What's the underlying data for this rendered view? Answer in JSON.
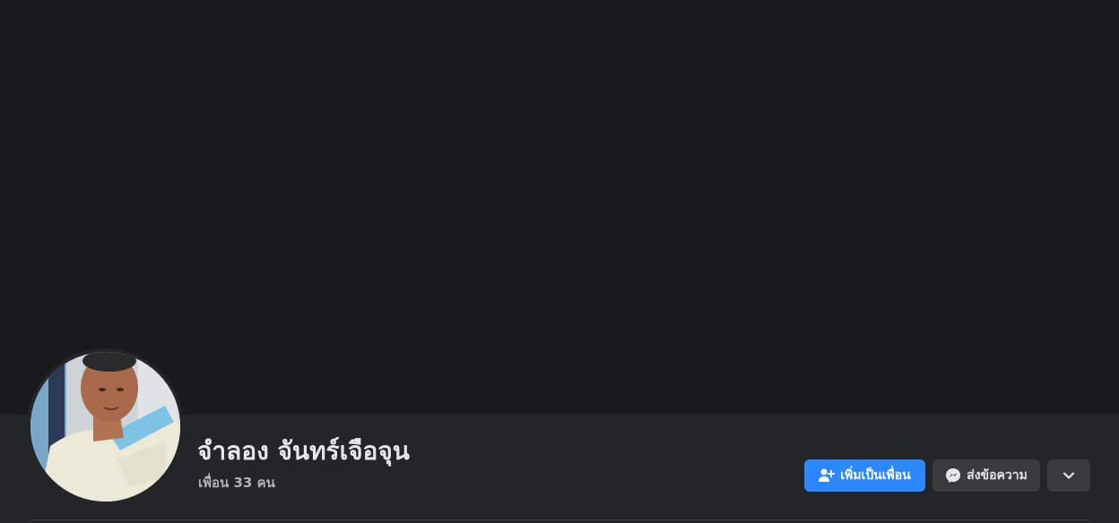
{
  "profile": {
    "name": "จำลอง จันทร์เจือจุน",
    "friends_text": "เพื่อน 33 คน"
  },
  "actions": {
    "add_friend_label": "เพิ่มเป็นเพื่อน",
    "add_friend_icon": "add-friend-icon",
    "message_label": "ส่งข้อความ",
    "message_icon": "messenger-icon",
    "more_icon": "chevron-down-icon"
  },
  "colors": {
    "background": "#1a1a1c",
    "profile_bar": "#242527",
    "primary_button": "#2d88ff",
    "secondary_button": "#3a3b3c",
    "text_primary": "#e4e6eb",
    "text_secondary": "#b0b3b8"
  }
}
